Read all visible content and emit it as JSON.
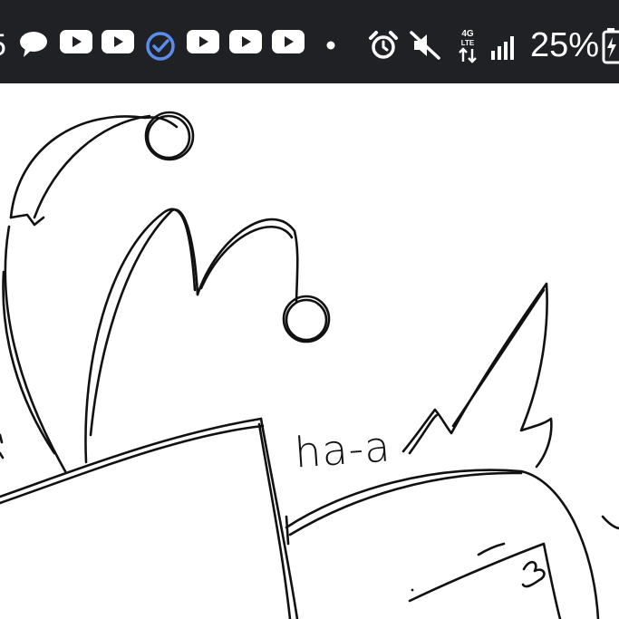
{
  "status_bar": {
    "clipped_number": "5",
    "battery_percent": "25%",
    "network_label": "4G LTE",
    "icons": [
      "chat-bubble-icon",
      "youtube-icon",
      "youtube-icon",
      "verified-check-icon",
      "youtube-icon",
      "youtube-icon",
      "youtube-icon",
      "dot-icon",
      "alarm-icon",
      "muted-icon",
      "lte-data-icon",
      "signal-icon",
      "battery-charging-icon"
    ],
    "colors": {
      "background": "#202124",
      "foreground": "#ffffff",
      "check": "#5b8def"
    }
  },
  "drawing": {
    "handwritten_text": "ha-a",
    "background": "#ffffff",
    "stroke": "#111111"
  }
}
